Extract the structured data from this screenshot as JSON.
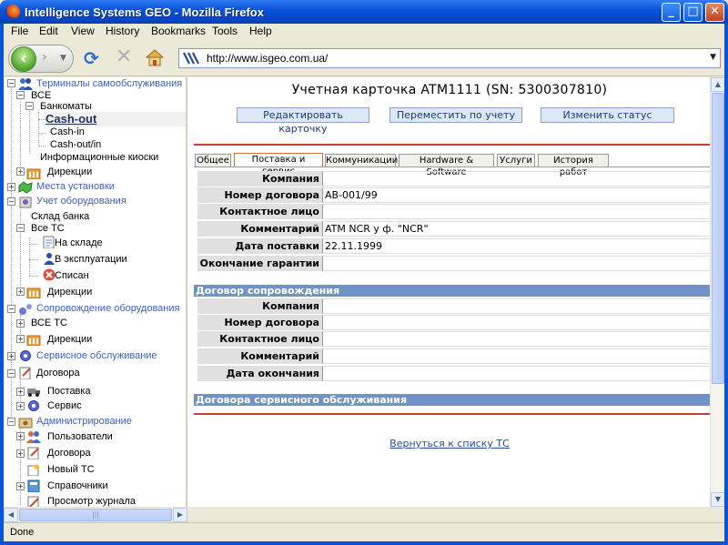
{
  "window": {
    "title": "Intelligence Systems GEO - Mozilla Firefox"
  },
  "menu": [
    "File",
    "Edit",
    "View",
    "History",
    "Bookmarks",
    "Tools",
    "Help"
  ],
  "address": {
    "url": "http://www.isgeo.com.ua/"
  },
  "tree": {
    "n0": "Терминалы самообслуживания",
    "n1": "ВСЕ",
    "n2": "Банкоматы",
    "n3": "Cash-out",
    "n4": "Cash-in",
    "n5": "Cash-out/in",
    "n6": "Информационные киоски",
    "n7": "Дирекции",
    "n8": "Места установки",
    "n9": "Учет оборудования",
    "n10": "Склад банка",
    "n11": "Все ТС",
    "n12": "На складе",
    "n13": "В эксплуатации",
    "n14": "Списан",
    "n15": "Дирекции",
    "n16": "Сопровождение оборудования",
    "n17": "ВСЕ ТС",
    "n18": "Дирекции",
    "n19": "Сервисное обслуживание",
    "n20": "Договора",
    "n21": "Поставка",
    "n22": "Сервис",
    "n23": "Администрирование",
    "n24": "Пользователи",
    "n25": "Договора",
    "n26": "Новый ТС",
    "n27": "Справочники",
    "n28": "Просмотр журнала"
  },
  "card": {
    "title": "Учетная карточка ATM1111 (SN: 5300307810)",
    "buttons": {
      "edit": "Редактировать карточку",
      "move": "Переместить по учету",
      "status": "Изменить статус"
    },
    "tabs": [
      "Общее",
      "Поставка и сервис",
      "Коммуникации",
      "Hardware & Software",
      "Услуги",
      "История работ"
    ],
    "supply": [
      {
        "label": "Компания",
        "value": ""
      },
      {
        "label": "Номер договора",
        "value": "AB-001/99"
      },
      {
        "label": "Контактное лицо",
        "value": ""
      },
      {
        "label": "Комментарий",
        "value": "ATM NCR у ф. \"NCR\""
      },
      {
        "label": "Дата поставки",
        "value": "22.11.1999"
      },
      {
        "label": "Окончание гарантии",
        "value": ""
      }
    ],
    "support_section": "Договор сопровождения",
    "support": [
      {
        "label": "Компания",
        "value": ""
      },
      {
        "label": "Номер договора",
        "value": ""
      },
      {
        "label": "Контактное лицо",
        "value": ""
      },
      {
        "label": "Комментарий",
        "value": ""
      },
      {
        "label": "Дата окончания",
        "value": ""
      }
    ],
    "service_section": "Договора сервисного обслуживания",
    "back_link": "Вернуться к списку ТС"
  },
  "status": {
    "text": "Done"
  },
  "colors": {
    "titlebar": "#0a54d8",
    "section": "#7192c4",
    "accent_line": "#c8412b"
  }
}
